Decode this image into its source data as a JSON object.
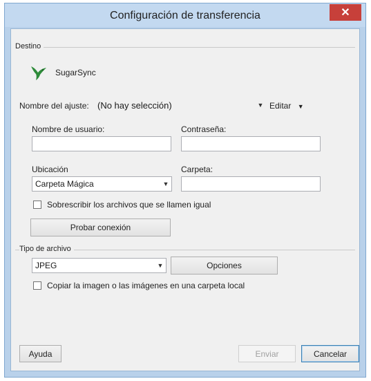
{
  "window": {
    "title": "Configuración de transferencia",
    "close_glyph": "✕"
  },
  "destino": {
    "section_label": "Destino",
    "service_name": "SugarSync",
    "logo_icon": "hummingbird-logo-icon",
    "setting_name_label": "Nombre del ajuste:",
    "setting_name_value": "(No hay selección)",
    "edit_label": "Editar",
    "username_label": "Nombre de usuario:",
    "username_value": "",
    "password_label": "Contraseña:",
    "password_value": "",
    "location_label": "Ubicación",
    "location_value": "Carpeta Mágica",
    "folder_label": "Carpeta:",
    "folder_value": "",
    "overwrite_label": "Sobrescribir los archivos que se llamen igual",
    "overwrite_checked": false,
    "test_button_label": "Probar conexión"
  },
  "file_type": {
    "section_label": "Tipo de archivo",
    "format_value": "JPEG",
    "options_button_label": "Opciones",
    "copy_local_label": "Copiar la imagen o las imágenes en una carpeta local",
    "copy_local_checked": false
  },
  "footer": {
    "help_label": "Ayuda",
    "send_label": "Enviar",
    "cancel_label": "Cancelar"
  },
  "colors": {
    "title_bar": "#c3d9f0",
    "close_button": "#c7403a",
    "dialog_background": "#f0f0f0",
    "logo_green": "#2e8b3a"
  }
}
